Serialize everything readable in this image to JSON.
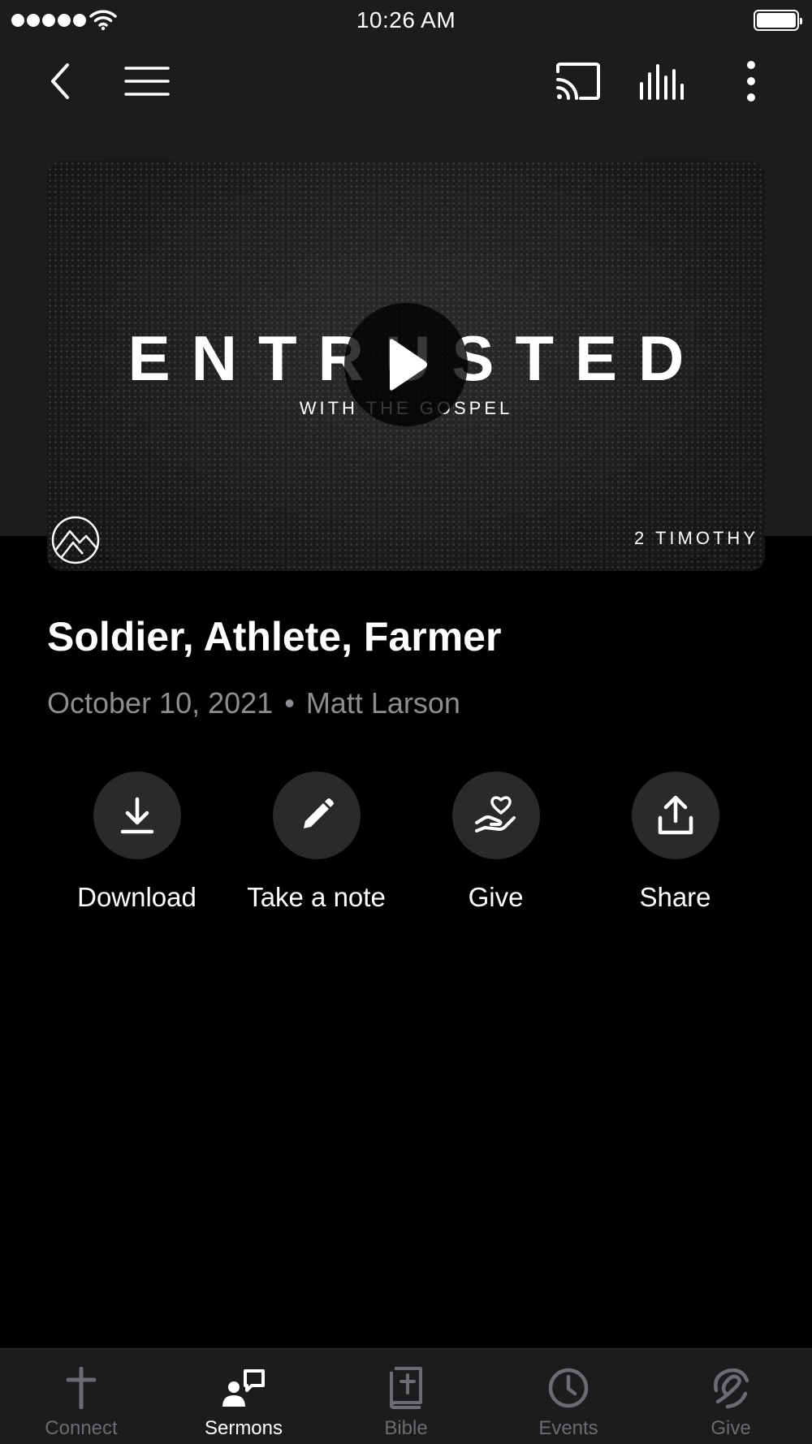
{
  "status_bar": {
    "time": "10:26 AM"
  },
  "nav": {
    "back_icon": "chevron-left-icon",
    "menu_icon": "hamburger-icon",
    "cast_icon": "cast-icon",
    "audio_icon": "audio-bars-icon",
    "more_icon": "more-vertical-icon"
  },
  "hero": {
    "title": "ENTRUSTED",
    "subtitle": "WITH THE GOSPEL",
    "series": "2 TIMOTHY",
    "play_icon": "play-icon",
    "logo_icon": "mountain-logo-icon"
  },
  "sermon": {
    "title": "Soldier, Athlete, Farmer",
    "date": "October 10, 2021",
    "separator": "•",
    "speaker": "Matt Larson"
  },
  "actions": [
    {
      "label": "Download",
      "icon": "download-icon"
    },
    {
      "label": "Take a note",
      "icon": "pencil-icon"
    },
    {
      "label": "Give",
      "icon": "heart-hand-icon"
    },
    {
      "label": "Share",
      "icon": "share-icon"
    }
  ],
  "tabs": [
    {
      "label": "Connect",
      "icon": "cross-icon",
      "active": false
    },
    {
      "label": "Sermons",
      "icon": "sermons-icon",
      "active": true
    },
    {
      "label": "Bible",
      "icon": "bible-icon",
      "active": false
    },
    {
      "label": "Events",
      "icon": "clock-icon",
      "active": false
    },
    {
      "label": "Give",
      "icon": "give-icon",
      "active": false
    }
  ],
  "colors": {
    "background": "#000000",
    "header_background": "#1c1c1e",
    "action_circle": "#2a2a2c",
    "meta_text": "#8d8d92",
    "inactive_tab": "#6c6c70",
    "active_tab": "#ffffff"
  }
}
